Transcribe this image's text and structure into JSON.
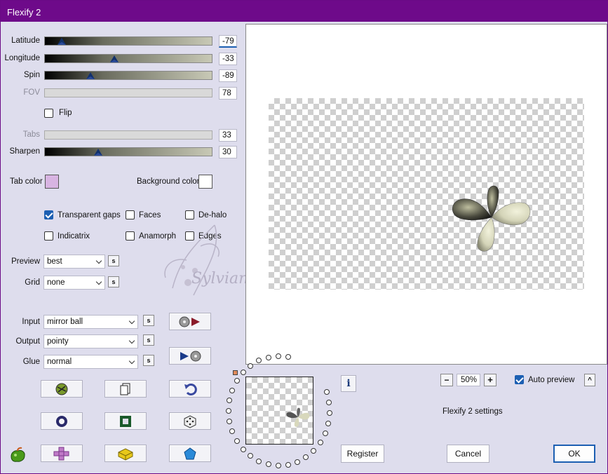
{
  "window": {
    "title": "Flexify 2"
  },
  "sliders": [
    {
      "label": "Latitude",
      "value": "-79",
      "level": 0.08,
      "enabled": true
    },
    {
      "label": "Longitude",
      "value": "-33",
      "level": 0.41,
      "enabled": true
    },
    {
      "label": "Spin",
      "value": "-89",
      "level": 0.26,
      "enabled": true
    },
    {
      "label": "FOV",
      "value": "78",
      "level": null,
      "enabled": false
    }
  ],
  "flip": {
    "label": "Flip",
    "checked": false
  },
  "tabs": {
    "label": "Tabs",
    "value": "33",
    "enabled": false
  },
  "sharpen": {
    "label": "Sharpen",
    "value": "30",
    "level": 0.31
  },
  "tab_color": {
    "label": "Tab color",
    "color": "#d8b4e2"
  },
  "background_color": {
    "label": "Background color",
    "color": "#ffffff"
  },
  "options": [
    {
      "label": "Transparent gaps",
      "checked": true
    },
    {
      "label": "Faces",
      "checked": false
    },
    {
      "label": "De-halo",
      "checked": false
    },
    {
      "label": "Indicatrix",
      "checked": false
    },
    {
      "label": "Anamorph",
      "checked": false
    },
    {
      "label": "Edges",
      "checked": false
    }
  ],
  "preview": {
    "label": "Preview",
    "value": "best",
    "s": "s"
  },
  "grid": {
    "label": "Grid",
    "value": "none",
    "s": "s"
  },
  "input": {
    "label": "Input",
    "value": "mirror ball",
    "s": "s"
  },
  "output": {
    "label": "Output",
    "value": "pointy",
    "s": "s"
  },
  "glue": {
    "label": "Glue",
    "value": "normal",
    "s": "s"
  },
  "zoom": {
    "value": "50%",
    "minus": "−",
    "plus": "+"
  },
  "auto_preview": {
    "label": "Auto preview",
    "checked": true,
    "collapse": "^"
  },
  "settings_label": "Flexify 2 settings",
  "info": "i",
  "watermark": "Sylviane",
  "buttons": {
    "register": "Register",
    "cancel": "Cancel",
    "ok": "OK"
  },
  "colors": {
    "title_bar": "#6e0a8a",
    "accent": "#1c5fb2"
  }
}
